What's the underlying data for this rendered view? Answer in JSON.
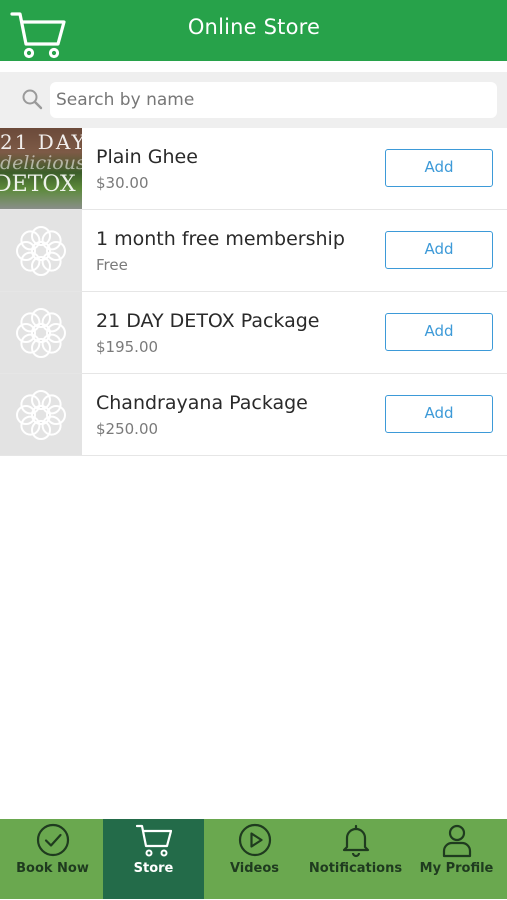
{
  "header": {
    "title": "Online Store",
    "logo_icon": "shopping-cart-icon",
    "background_color": "#27a24a"
  },
  "search": {
    "placeholder": "Search by name",
    "value": ""
  },
  "products": [
    {
      "name": "Plain Ghee",
      "price": "$30.00",
      "button_label": "Add",
      "thumbnail": "detox-photo"
    },
    {
      "name": "1 month free membership",
      "price": "Free",
      "button_label": "Add",
      "thumbnail": "flower-placeholder-icon"
    },
    {
      "name": "21 DAY DETOX Package",
      "price": "$195.00",
      "button_label": "Add",
      "thumbnail": "flower-placeholder-icon"
    },
    {
      "name": "Chandrayana Package",
      "price": "$250.00",
      "button_label": "Add",
      "thumbnail": "flower-placeholder-icon"
    }
  ],
  "thumbnail_text": {
    "line1": "21 DAY",
    "line2": "delicious",
    "line3": "DETOX"
  },
  "tab_bar": {
    "background_color": "#6aa84f",
    "active_color": "#236b49",
    "tabs": [
      {
        "label": "Book Now",
        "icon": "check-circle-icon",
        "active": false
      },
      {
        "label": "Store",
        "icon": "shopping-cart-icon",
        "active": true
      },
      {
        "label": "Videos",
        "icon": "play-circle-icon",
        "active": false
      },
      {
        "label": "Notifications",
        "icon": "bell-icon",
        "active": false
      },
      {
        "label": "My Profile",
        "icon": "user-icon",
        "active": false
      }
    ]
  },
  "colors": {
    "accent_blue": "#3d9ad8"
  }
}
